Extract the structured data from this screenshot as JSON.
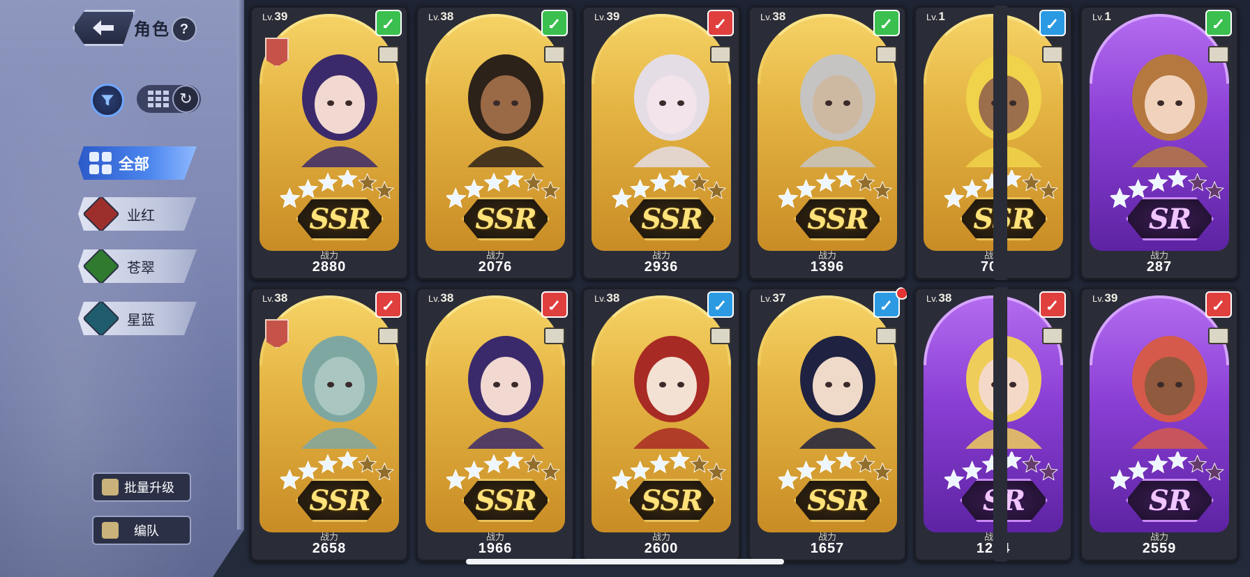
{
  "header": {
    "title": "角色",
    "help_label": "?"
  },
  "categories": [
    {
      "label": "全部",
      "color": "#3f76e6",
      "selected": true
    },
    {
      "label": "业红",
      "color": "#9c2f2c"
    },
    {
      "label": "苍翠",
      "color": "#2f7a2f"
    },
    {
      "label": "星蓝",
      "color": "#1f5d6e"
    }
  ],
  "actions": {
    "batch_upgrade": "批量升级",
    "team": "编队"
  },
  "power_label": "战力",
  "level_prefix": "Lv.",
  "cards": [
    {
      "level": "39",
      "rarity": "SSR",
      "element": "green",
      "power": "2880",
      "crest": true,
      "skin": "#f1d9d2",
      "hair": "#3b2a6b"
    },
    {
      "level": "38",
      "rarity": "SSR",
      "element": "green",
      "power": "2076",
      "crest": false,
      "skin": "#9a6a47",
      "hair": "#2d2219"
    },
    {
      "level": "39",
      "rarity": "SSR",
      "element": "red",
      "power": "2936",
      "crest": false,
      "skin": "#f3e3ea",
      "hair": "#e4dde5"
    },
    {
      "level": "38",
      "rarity": "SSR",
      "element": "green",
      "power": "1396",
      "crest": false,
      "skin": "#cdb8a2",
      "hair": "#c6c4c2"
    },
    {
      "level": "1",
      "rarity": "SSR",
      "element": "blue",
      "power": "709",
      "crest": false,
      "skin": "#9b6e4c",
      "hair": "#f0d34a"
    },
    {
      "level": "1",
      "rarity": "SR",
      "element": "green",
      "power": "287",
      "crest": false,
      "skin": "#f1d3bd",
      "hair": "#b5783f"
    },
    {
      "level": "38",
      "rarity": "SSR",
      "element": "red",
      "power": "2658",
      "crest": true,
      "skin": "#a9c6c1",
      "hair": "#7fa7a2"
    },
    {
      "level": "38",
      "rarity": "SSR",
      "element": "red",
      "power": "1966",
      "crest": false,
      "skin": "#f1d9d2",
      "hair": "#3b2a6b"
    },
    {
      "level": "38",
      "rarity": "SSR",
      "element": "blue",
      "power": "2600",
      "crest": false,
      "skin": "#f3e1d4",
      "hair": "#a82a24"
    },
    {
      "level": "37",
      "rarity": "SSR",
      "element": "blue",
      "power": "1657",
      "crest": false,
      "skin": "#efd9c9",
      "hair": "#1f2240",
      "notify": true
    },
    {
      "level": "38",
      "rarity": "SR",
      "element": "red",
      "power": "1274",
      "crest": false,
      "skin": "#f5d9c8",
      "hair": "#efcd5a"
    },
    {
      "level": "39",
      "rarity": "SR",
      "element": "red",
      "power": "2559",
      "crest": false,
      "skin": "#8f5a3e",
      "hair": "#d55a4b"
    }
  ]
}
